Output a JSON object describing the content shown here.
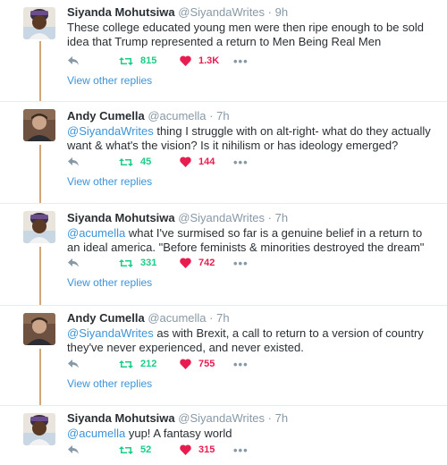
{
  "tweets": [
    {
      "name": "Siyanda Mohutsiwa",
      "handle": "@SiyandaWrites",
      "time": "9h",
      "mention": "",
      "text": "These college educated young men were then ripe enough to be sold idea that Trump represented a return to Men Being Real Men",
      "retweets": "815",
      "likes": "1.3K",
      "view_replies": "View other replies"
    },
    {
      "name": "Andy Cumella",
      "handle": "@acumella",
      "time": "7h",
      "mention": "@SiyandaWrites",
      "text": " thing I struggle with on alt-right- what do they actually want & what's the vision? Is it nihilism or has ideology emerged?",
      "retweets": "45",
      "likes": "144",
      "view_replies": "View other replies"
    },
    {
      "name": "Siyanda Mohutsiwa",
      "handle": "@SiyandaWrites",
      "time": "7h",
      "mention": "@acumella",
      "text": " what I've surmised so far is a genuine belief in a return to an ideal america. \"Before feminists & minorities destroyed the dream\"",
      "retweets": "331",
      "likes": "742",
      "view_replies": "View other replies"
    },
    {
      "name": "Andy Cumella",
      "handle": "@acumella",
      "time": "7h",
      "mention": "@SiyandaWrites",
      "text": " as with Brexit, a call to return to a version of country they've never experienced, and never existed.",
      "retweets": "212",
      "likes": "755",
      "view_replies": "View other replies"
    },
    {
      "name": "Siyanda Mohutsiwa",
      "handle": "@SiyandaWrites",
      "time": "7h",
      "mention": "@acumella",
      "text": " yup! A fantasy world",
      "retweets": "52",
      "likes": "315",
      "view_replies": ""
    }
  ],
  "separator": "·",
  "more_label": "•••",
  "colors": {
    "retweet": "#19cf86",
    "like": "#e81c4f",
    "link": "#3b94d9",
    "muted": "#8899a6",
    "thread_line": "#d2a679"
  }
}
